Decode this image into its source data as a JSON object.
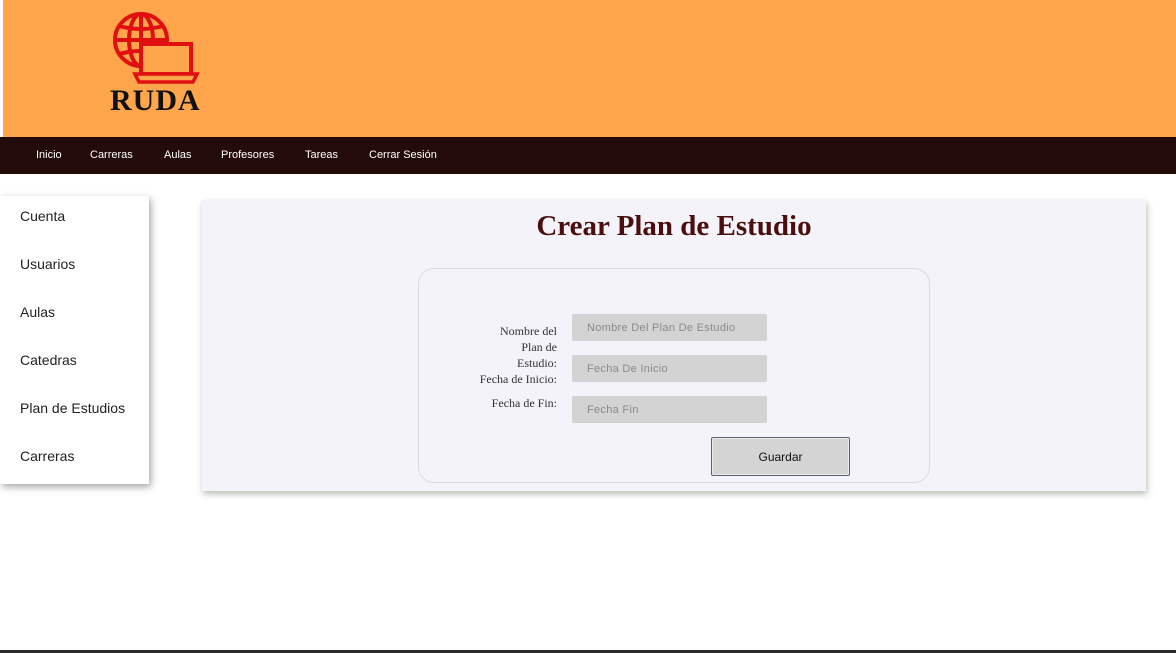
{
  "brand": {
    "name": "RUDA",
    "icon": "globe-laptop-logo-icon",
    "logo_color": "#e01010"
  },
  "colors": {
    "header_bg": "#ffa54b",
    "nav_bg": "#230b0a",
    "title": "#4a0e0e"
  },
  "nav": {
    "items": [
      {
        "label": "Inicio"
      },
      {
        "label": "Carreras"
      },
      {
        "label": "Aulas"
      },
      {
        "label": "Profesores"
      },
      {
        "label": "Tareas"
      },
      {
        "label": "Cerrar Sesión"
      }
    ]
  },
  "sidebar": {
    "items": [
      {
        "label": "Cuenta"
      },
      {
        "label": "Usuarios"
      },
      {
        "label": "Aulas"
      },
      {
        "label": "Catedras"
      },
      {
        "label": "Plan de Estudios"
      },
      {
        "label": "Carreras"
      }
    ]
  },
  "form": {
    "title": "Crear Plan de Estudio",
    "labels": {
      "name": "Nombre del Plan de Estudio:",
      "start": "Fecha de Inicio:",
      "end": "Fecha de Fin:"
    },
    "fields": {
      "name": {
        "placeholder": "Nombre Del Plan De Estudio",
        "value": ""
      },
      "start": {
        "placeholder": "Fecha De Inicio",
        "value": ""
      },
      "end": {
        "placeholder": "Fecha Fin",
        "value": ""
      }
    },
    "submit_label": "Guardar"
  }
}
